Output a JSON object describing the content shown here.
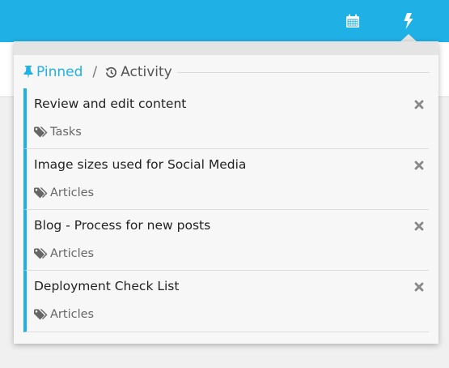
{
  "header": {
    "accent_color": "#1fb0e6",
    "icons": [
      "calendar-icon",
      "bolt-icon"
    ]
  },
  "popover": {
    "tabs": {
      "pinned_label": "Pinned",
      "separator": "/",
      "activity_label": "Activity"
    },
    "items": [
      {
        "title": "Review and edit content",
        "tag": "Tasks"
      },
      {
        "title": "Image sizes used for Social Media",
        "tag": "Articles"
      },
      {
        "title": "Blog - Process for new posts",
        "tag": "Articles"
      },
      {
        "title": "Deployment Check List",
        "tag": "Articles"
      }
    ]
  }
}
